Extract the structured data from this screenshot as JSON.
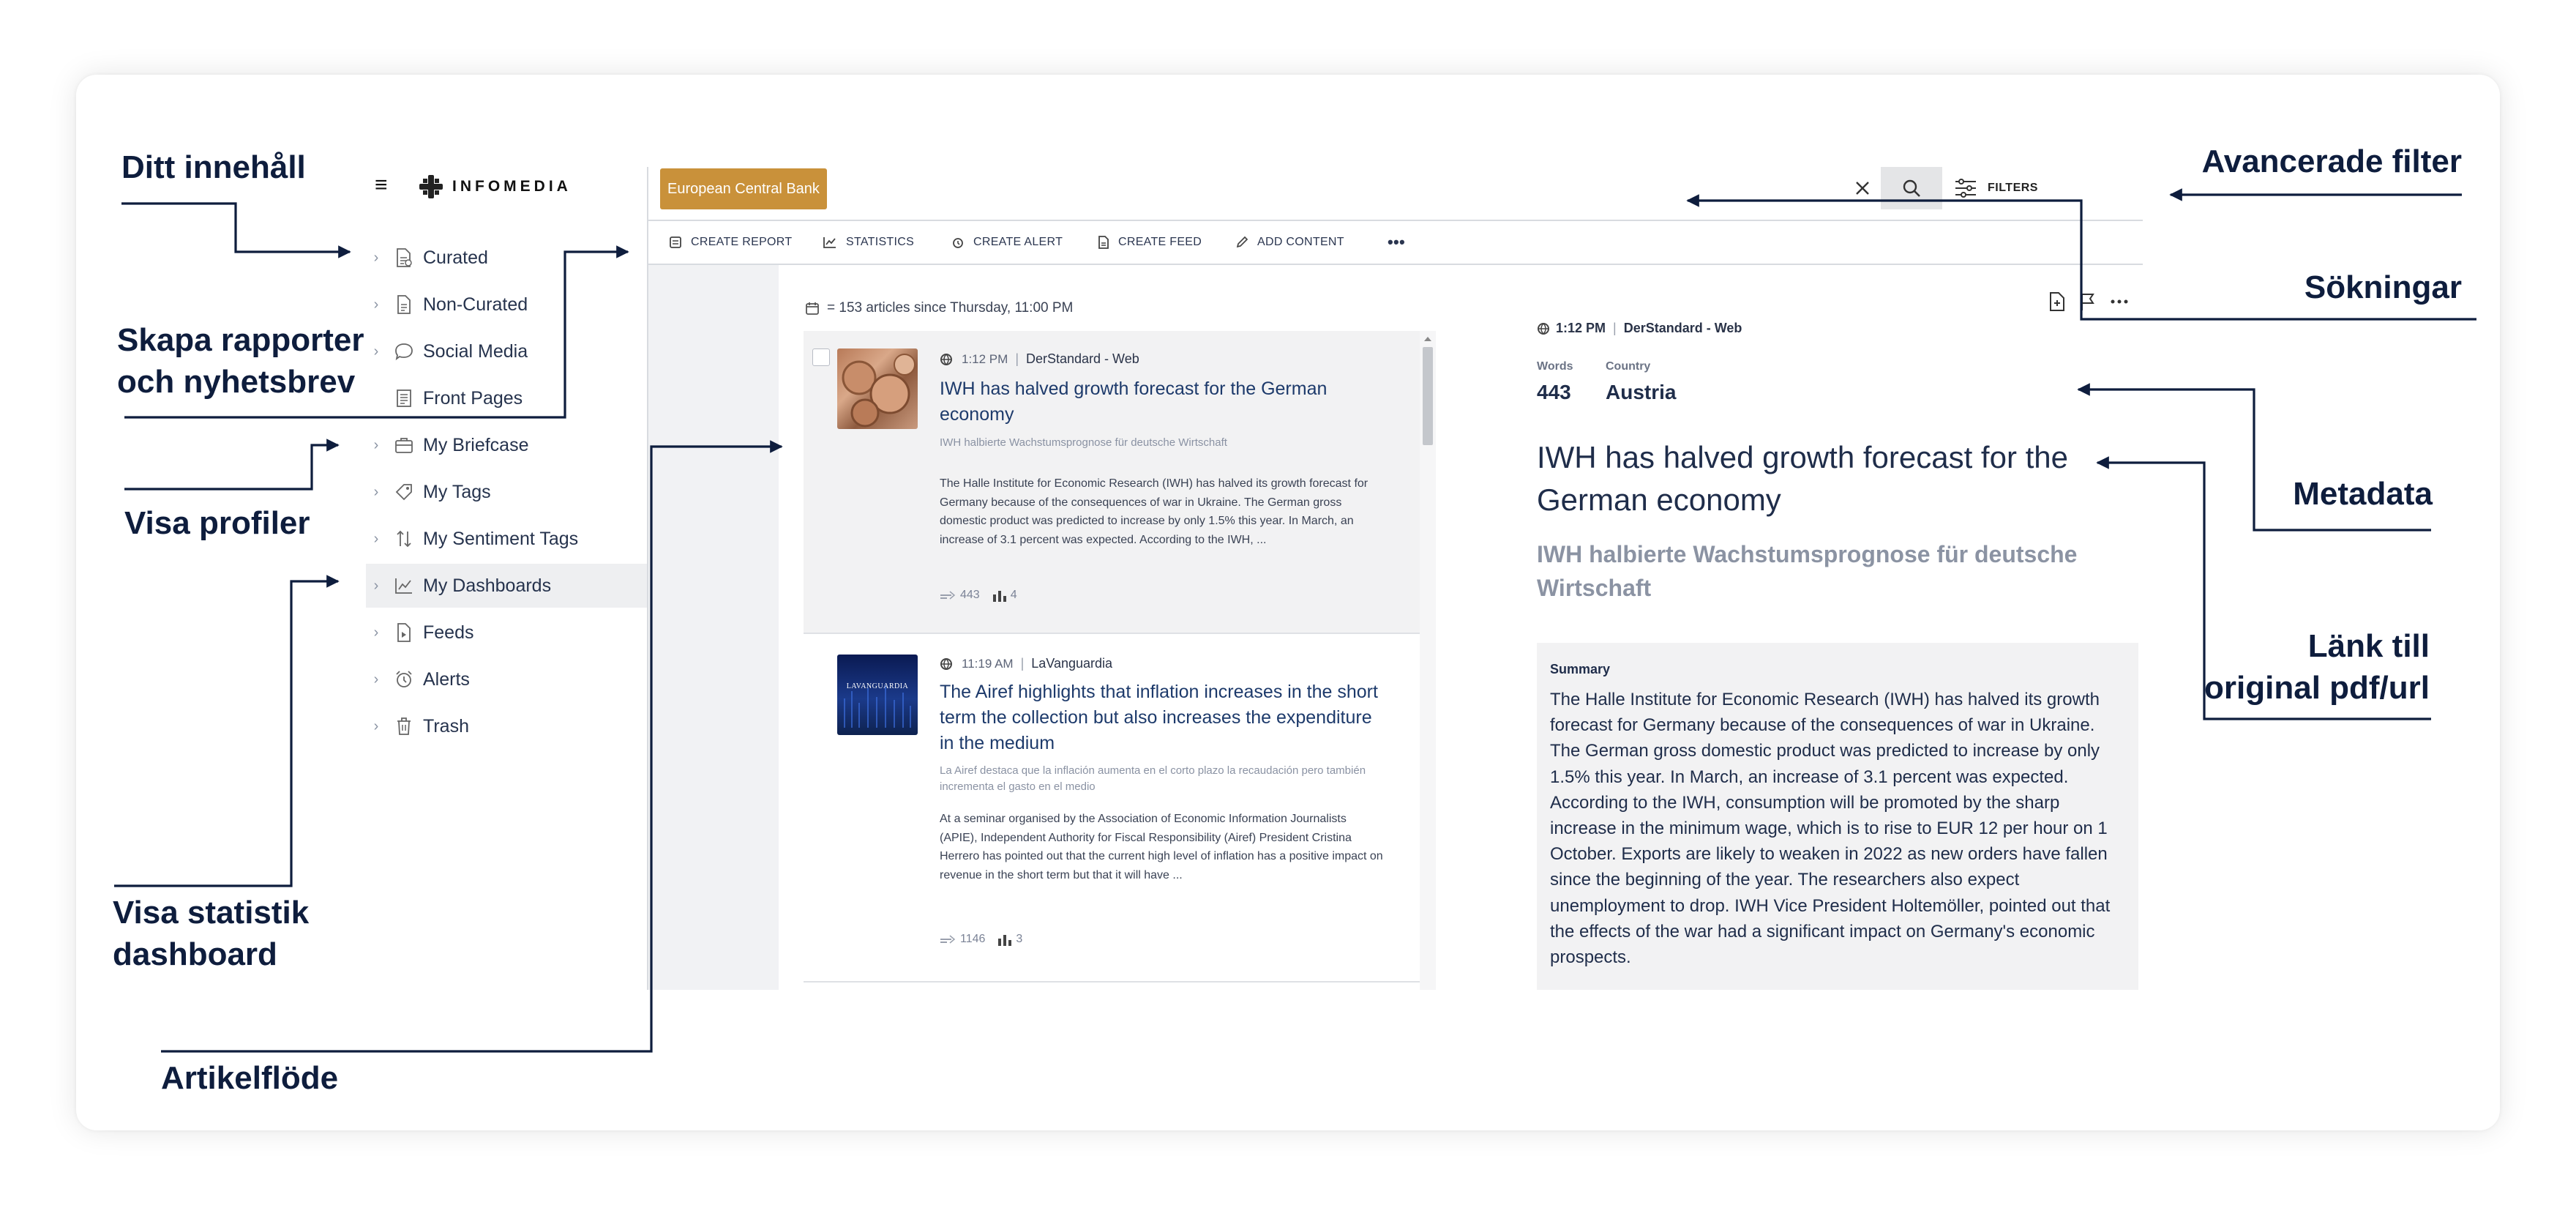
{
  "annotations": {
    "ditt_innehall": "Ditt innehåll",
    "skapa_rapporter": "Skapa rapporter\noch nyhetsbrev",
    "visa_profiler": "Visa profiler",
    "visa_statistik": "Visa statistik\ndashboard",
    "artikelflode": "Artikelflöde",
    "avancerade_filter": "Avancerade filter",
    "sokningar": "Sökningar",
    "metadata": "Metadata",
    "lank": "Länk till\noriginal pdf/url"
  },
  "app": {
    "logo": "INFOMEDIA",
    "search_chip": "European Central Bank",
    "filters_label": "FILTERS"
  },
  "sidebar": {
    "items": [
      {
        "label": "Curated",
        "icon": "curated-doc-icon"
      },
      {
        "label": "Non-Curated",
        "icon": "document-icon"
      },
      {
        "label": "Social Media",
        "icon": "chat-bubble-icon"
      },
      {
        "label": "Front Pages",
        "icon": "newspaper-icon"
      },
      {
        "label": "My Briefcase",
        "icon": "briefcase-icon"
      },
      {
        "label": "My Tags",
        "icon": "tag-icon"
      },
      {
        "label": "My Sentiment Tags",
        "icon": "sort-arrows-icon"
      },
      {
        "label": "My Dashboards",
        "icon": "line-chart-icon"
      },
      {
        "label": "Feeds",
        "icon": "feed-icon"
      },
      {
        "label": "Alerts",
        "icon": "alarm-clock-icon"
      },
      {
        "label": "Trash",
        "icon": "trash-icon"
      }
    ],
    "active_index": 7
  },
  "toolbar": {
    "create_report": "CREATE REPORT",
    "statistics": "STATISTICS",
    "create_alert": "CREATE ALERT",
    "create_feed": "CREATE FEED",
    "add_content": "ADD CONTENT",
    "more": "•••"
  },
  "list": {
    "summary": "= 153 articles since Thursday, 11:00 PM",
    "articles": [
      {
        "time": "1:12 PM",
        "source": "DerStandard - Web",
        "title": "IWH has halved growth forecast for the German economy",
        "original_title": "IWH halbierte Wachstumsprognose für deutsche Wirtschaft",
        "body": "The Halle Institute for Economic Research (IWH) has halved its growth forecast for Germany because of the consequences of war in Ukraine. The German gross domestic product was predicted to increase by only 1.5% this year. In March, an increase of 3.1 percent was expected. According to the IWH, ...",
        "words": "443",
        "reach": "4"
      },
      {
        "time": "11:19 AM",
        "source": "LaVanguardia",
        "title": "The Airef highlights that inflation increases in the short term the collection but also increases the expenditure in the medium",
        "original_title": "La Airef destaca que la inflación aumenta en el corto plazo la recaudación pero también incrementa el gasto en el medio",
        "body": "At a seminar organised by the Association of Economic Information Journalists (APIE), Independent Authority for Fiscal Responsibility (Airef) President Cristina Herrero has pointed out that the current high level of inflation has a positive impact on revenue in the short term but that it will have ...",
        "words": "1146",
        "reach": "3",
        "thumb_text": "LAVANGUARDIA"
      }
    ]
  },
  "detail": {
    "time": "1:12 PM",
    "source": "DerStandard - Web",
    "words_label": "Words",
    "words_value": "443",
    "country_label": "Country",
    "country_value": "Austria",
    "title": "IWH has halved growth forecast for the German economy",
    "original_title": "IWH halbierte Wachstumsprognose für deutsche Wirtschaft",
    "summary_label": "Summary",
    "summary": "The Halle Institute for Economic Research (IWH) has halved its growth forecast for Germany because of the consequences of war in Ukraine. The German gross domestic product was predicted to increase by only 1.5% this year. In March, an increase of 3.1 percent was expected. According to the IWH, consumption will be promoted by the sharp increase in the minimum wage, which is to rise to EUR 12 per hour on 1 October. Exports are likely to weaken in 2022 as new orders have fallen since the beginning of the year. The researchers also expect unemployment to drop. IWH Vice President Holtemöller, pointed out that the effects of the war had a significant impact on Germany's economic prospects."
  },
  "colors": {
    "accent_chip": "#c9913a",
    "annotation_text": "#0e1d3d",
    "title_blue": "#1d3a6b"
  }
}
